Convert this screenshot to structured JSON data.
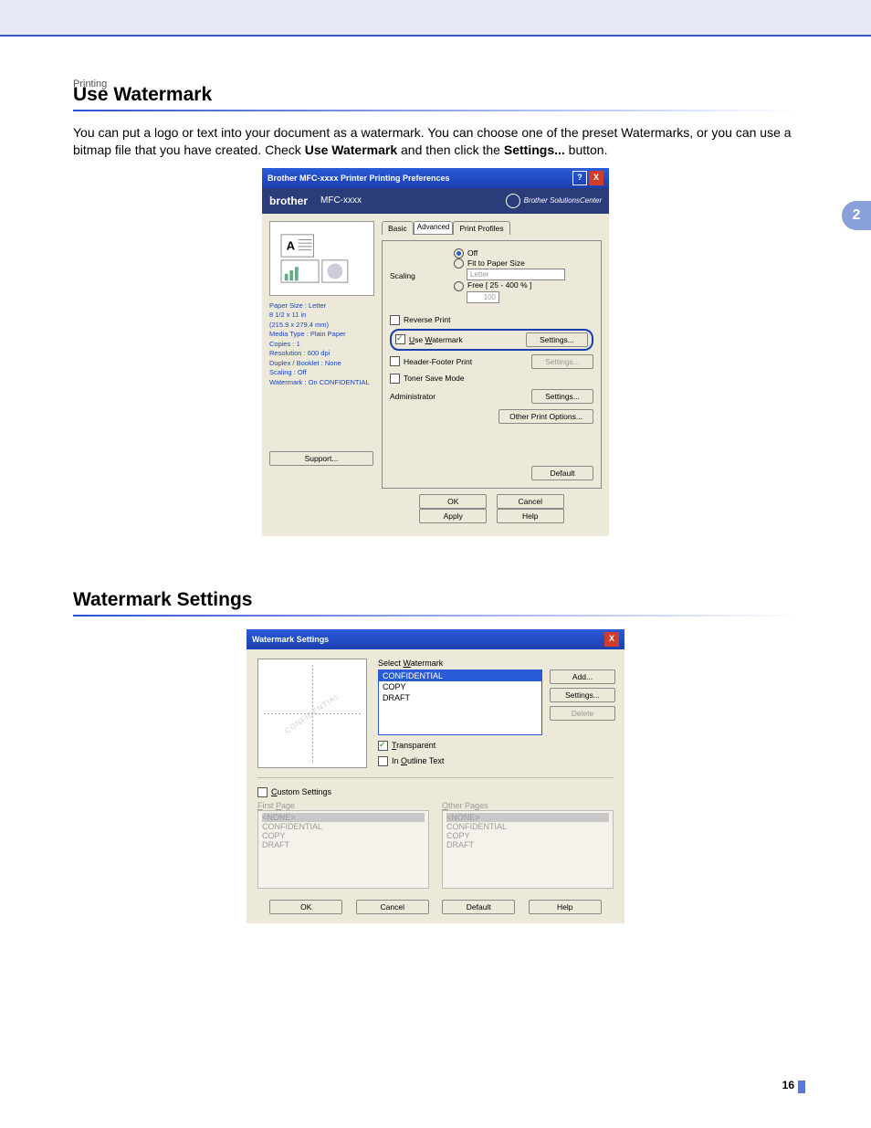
{
  "breadcrumb": "Printing",
  "sidetab": "2",
  "page_number": "16",
  "section1": {
    "heading": "Use Watermark",
    "para_pre": "You can put a logo or text into your document as a watermark. You can choose one of the preset Watermarks, or you can use a bitmap file that you have created. Check ",
    "para_b1": "Use Watermark",
    "para_mid": " and then click the ",
    "para_b2": "Settings...",
    "para_post": " button."
  },
  "dlg1": {
    "title": "Brother MFC-xxxx Printer Printing Preferences",
    "brand": "brother",
    "model": "MFC-xxxx",
    "solutions": "Brother\nSolutionsCenter",
    "preview_info": [
      "Paper Size : Letter",
      "8 1/2 x 11 in",
      "(215.9 x 279.4 mm)",
      "Media Type : Plain Paper",
      "Copies : 1",
      "Resolution : 600 dpi",
      "Duplex / Booklet : None",
      "Scaling : Off",
      "Watermark : On  CONFIDENTIAL"
    ],
    "support": "Support...",
    "tabs": {
      "basic": "Basic",
      "advanced": "Advanced",
      "profiles": "Print Profiles"
    },
    "scaling_label": "Scaling",
    "scaling": {
      "off": "Off",
      "fit": "Fit to Paper Size",
      "fit_value": "Letter",
      "free": "Free [ 25 - 400 % ]",
      "free_value": "100"
    },
    "reverse": "Reverse Print",
    "use_wm": "Use Watermark",
    "use_wm_btn": "Settings...",
    "hfp": "Header-Footer Print",
    "hfp_btn": "Settings...",
    "toner": "Toner Save Mode",
    "admin": "Administrator",
    "admin_btn": "Settings...",
    "other": "Other Print Options...",
    "default": "Default",
    "ok": "OK",
    "cancel": "Cancel",
    "apply": "Apply",
    "help": "Help"
  },
  "section2": {
    "heading": "Watermark Settings"
  },
  "dlg2": {
    "title": "Watermark Settings",
    "preview_text": "CONFIDENTIAL",
    "select_label": "Select Watermark",
    "list": [
      "CONFIDENTIAL",
      "COPY",
      "DRAFT"
    ],
    "add": "Add...",
    "settings": "Settings...",
    "delete": "Delete",
    "transparent": "Transparent",
    "outline": "In Outline Text",
    "custom": "Custom Settings",
    "first_page": "First Page",
    "other_pages": "Other Pages",
    "opts": [
      "<NONE>",
      "CONFIDENTIAL",
      "COPY",
      "DRAFT"
    ],
    "ok": "OK",
    "cancel": "Cancel",
    "default": "Default",
    "help": "Help"
  }
}
